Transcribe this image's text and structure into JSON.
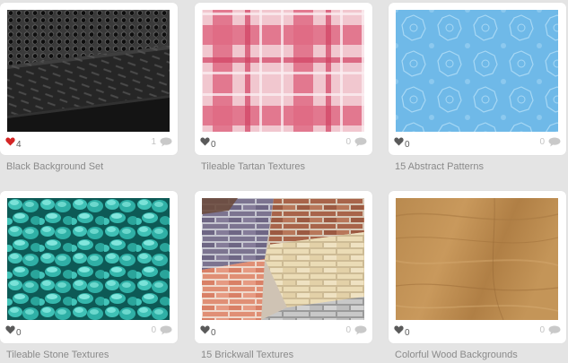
{
  "cards": [
    {
      "title": "Black Background Set",
      "likes": "4",
      "comments": "1",
      "liked": true
    },
    {
      "title": "Tileable Tartan Textures",
      "likes": "0",
      "comments": "0",
      "liked": false
    },
    {
      "title": "15 Abstract Patterns",
      "likes": "0",
      "comments": "0",
      "liked": false
    },
    {
      "title": "Tileable Stone Textures",
      "likes": "0",
      "comments": "0",
      "liked": false
    },
    {
      "title": "15 Brickwall Textures",
      "likes": "0",
      "comments": "0",
      "liked": false
    },
    {
      "title": "Colorful Wood Backgrounds",
      "likes": "0",
      "comments": "0",
      "liked": false
    }
  ],
  "colors": {
    "liked_heart": "#d42525",
    "heart": "#5a5a5a",
    "bubble": "#c9c9c9"
  },
  "icons": [
    "heart-icon",
    "comment-bubble-icon"
  ]
}
